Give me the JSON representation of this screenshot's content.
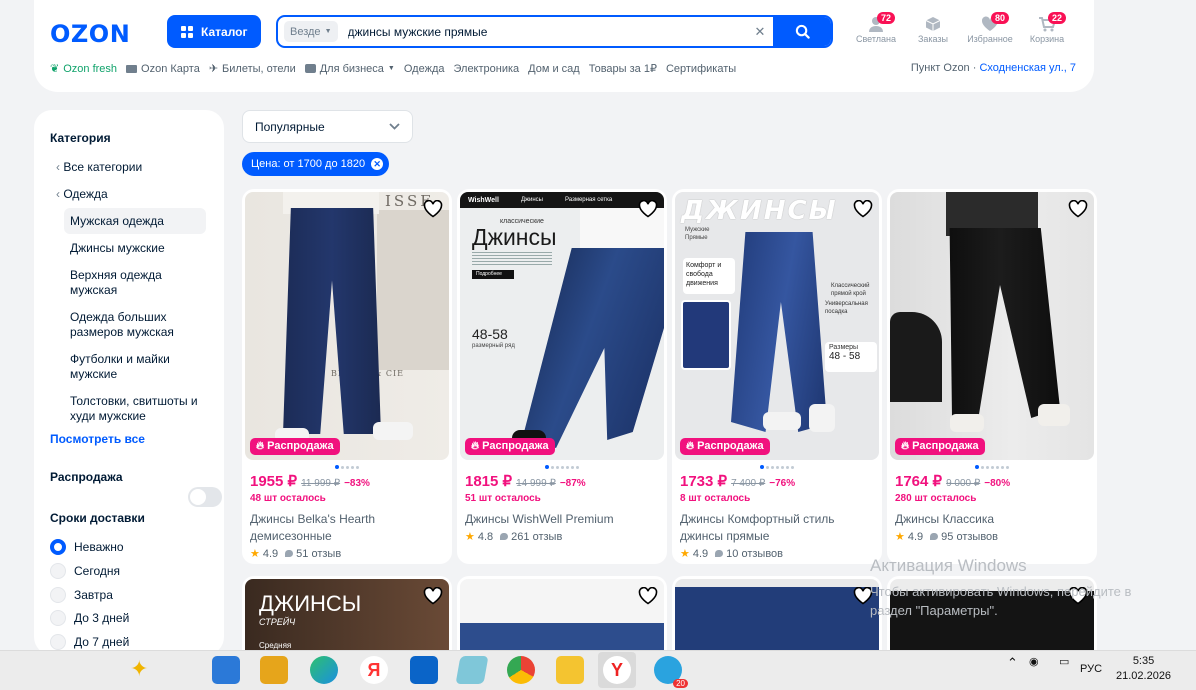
{
  "header": {
    "logo": "OZON",
    "catalog_label": "Каталог",
    "search_scope": "Везде",
    "search_query": "джинсы мужские прямые",
    "icons": [
      {
        "label": "Светлана",
        "badge": "72",
        "icon": "profile-icon"
      },
      {
        "label": "Заказы",
        "badge": "",
        "icon": "box-icon"
      },
      {
        "label": "Избранное",
        "badge": "80",
        "icon": "heart-icon"
      },
      {
        "label": "Корзина",
        "badge": "22",
        "icon": "cart-icon"
      }
    ],
    "nav": [
      "Ozon fresh",
      "Ozon Карта",
      "Билеты, отели",
      "Для бизнеса",
      "Одежда",
      "Электроника",
      "Дом и сад",
      "Товары за 1₽",
      "Сертификаты"
    ],
    "pickup_label": "Пункт Ozon ·",
    "pickup_address": "Сходненская ул., 7"
  },
  "sidebar": {
    "category_title": "Категория",
    "categories": [
      "Все категории",
      "Одежда",
      "Мужская одежда",
      "Джинсы мужские",
      "Верхняя одежда мужская",
      "Одежда больших размеров мужская",
      "Футболки и майки мужские",
      "Толстовки, свитшоты и худи мужские"
    ],
    "see_all": "Посмотреть все",
    "sale_label": "Распродажа",
    "delivery_title": "Сроки доставки",
    "delivery_options": [
      "Неважно",
      "Сегодня",
      "Завтра",
      "До 3 дней",
      "До 7 дней"
    ]
  },
  "sort_label": "Популярные",
  "filter_chip": "Цена: от 1700 до 1820",
  "sale_badge": "Распродажа",
  "products": [
    {
      "price": "1955 ₽",
      "old_price": "11 999 ₽",
      "discount": "−83%",
      "stock": "48 шт осталось",
      "title": "Джинсы Belka's Hearth демисезонные",
      "rating": "4.9",
      "reviews": "51 отзыв"
    },
    {
      "price": "1815 ₽",
      "old_price": "14 999 ₽",
      "discount": "−87%",
      "stock": "51 шт осталось",
      "title": "Джинсы WishWell Premium",
      "rating": "4.8",
      "reviews": "261 отзыв"
    },
    {
      "price": "1733 ₽",
      "old_price": "7 400 ₽",
      "discount": "−76%",
      "stock": "8 шт осталось",
      "title": "Джинсы Комфортный стиль джинсы прямые",
      "rating": "4.9",
      "reviews": "10 отзывов"
    },
    {
      "price": "1764 ₽",
      "old_price": "9 000 ₽",
      "discount": "−80%",
      "stock": "280 шт осталось",
      "title": "Джинсы Классика",
      "rating": "4.9",
      "reviews": "95 отзывов"
    }
  ],
  "image_texts": {
    "card1_brand": "ISSE",
    "card1_sign": "BERG N & CIE",
    "card2_brand": "WishWell",
    "card2_nav1": "Джинсы",
    "card2_nav2": "Размерная сетка",
    "card2_small": "классические",
    "card2_big": "Джинсы",
    "card2_button": "Подробнее",
    "card2_sizes": "48-58",
    "card2_sizes_sub": "размерный ряд",
    "card3_title": "ДЖИНСЫ",
    "card3_sub": "Мужские Прямые",
    "card3_comfort": "Комфорт и свобода движения",
    "card3_classic": "Классический прямой крой",
    "card3_universal": "Универсальная посадка",
    "card3_sizes_label": "Размеры",
    "card3_sizes": "48 - 58",
    "row2_title": "ДЖИНСЫ",
    "row2_sub": "СТРЕЙЧ",
    "row2_tag": "Средняя"
  },
  "watermark": {
    "title": "Активация Windows",
    "line1": "Чтобы активировать Windows, перейдите в",
    "line2": "раздел \"Параметры\"."
  },
  "taskbar": {
    "lang": "РУС",
    "time": "5:35",
    "date": "21.02.2026",
    "telegram_badge": "20"
  },
  "colors": {
    "brand": "#005bff",
    "sale": "#f1117e",
    "bg": "#f2f3f5"
  }
}
